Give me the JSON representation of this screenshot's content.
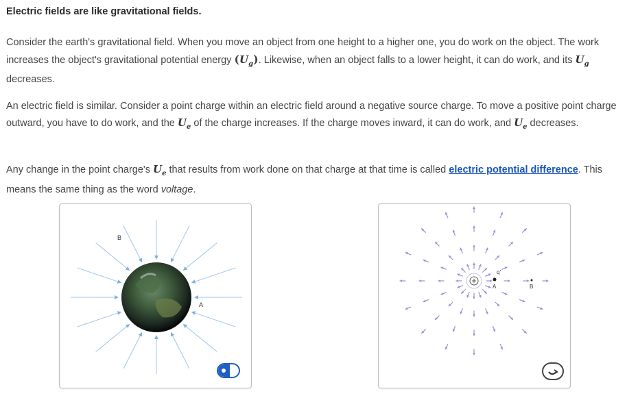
{
  "heading": "Electric fields are like gravitational fields.",
  "para1": {
    "t1": "Consider the earth's gravitational field. When you move an object from one height to a higher one, you do work on the object. The work increases the object's gravitational potential energy ",
    "var_g": "U",
    "sub_g": "g",
    "t2": ". Likewise, when an object falls to a lower height, it can do work, and its ",
    "t3": " decreases."
  },
  "para2": {
    "t1": "An electric field is similar. Consider a point charge within an electric field around a negative source charge. To move a positive point charge outward, you have to do work, and the ",
    "var_e": "U",
    "sub_e": "e",
    "t2": " of the charge increases. If the charge moves inward, it can do work, and ",
    "t3": " decreases."
  },
  "para3": {
    "t1": "Any change in the point charge's ",
    "t2": " that results from work done on that charge at that time is called ",
    "link": "electric potential difference",
    "t3": ". This means the same thing as the word ",
    "em": "voltage",
    "t4": "."
  },
  "left_panel": {
    "label_b": "B",
    "label_a": "A",
    "toggle_icon": "toggle-icon"
  },
  "right_panel": {
    "label_q": "q'",
    "label_a": "A",
    "label_b": "B",
    "reset_icon": "rotate-icon"
  },
  "colors": {
    "link": "#1a56b8",
    "toggle": "#1f5fbf",
    "field_blue": "#7fb2e0",
    "field_purple": "#9b8fd6"
  }
}
